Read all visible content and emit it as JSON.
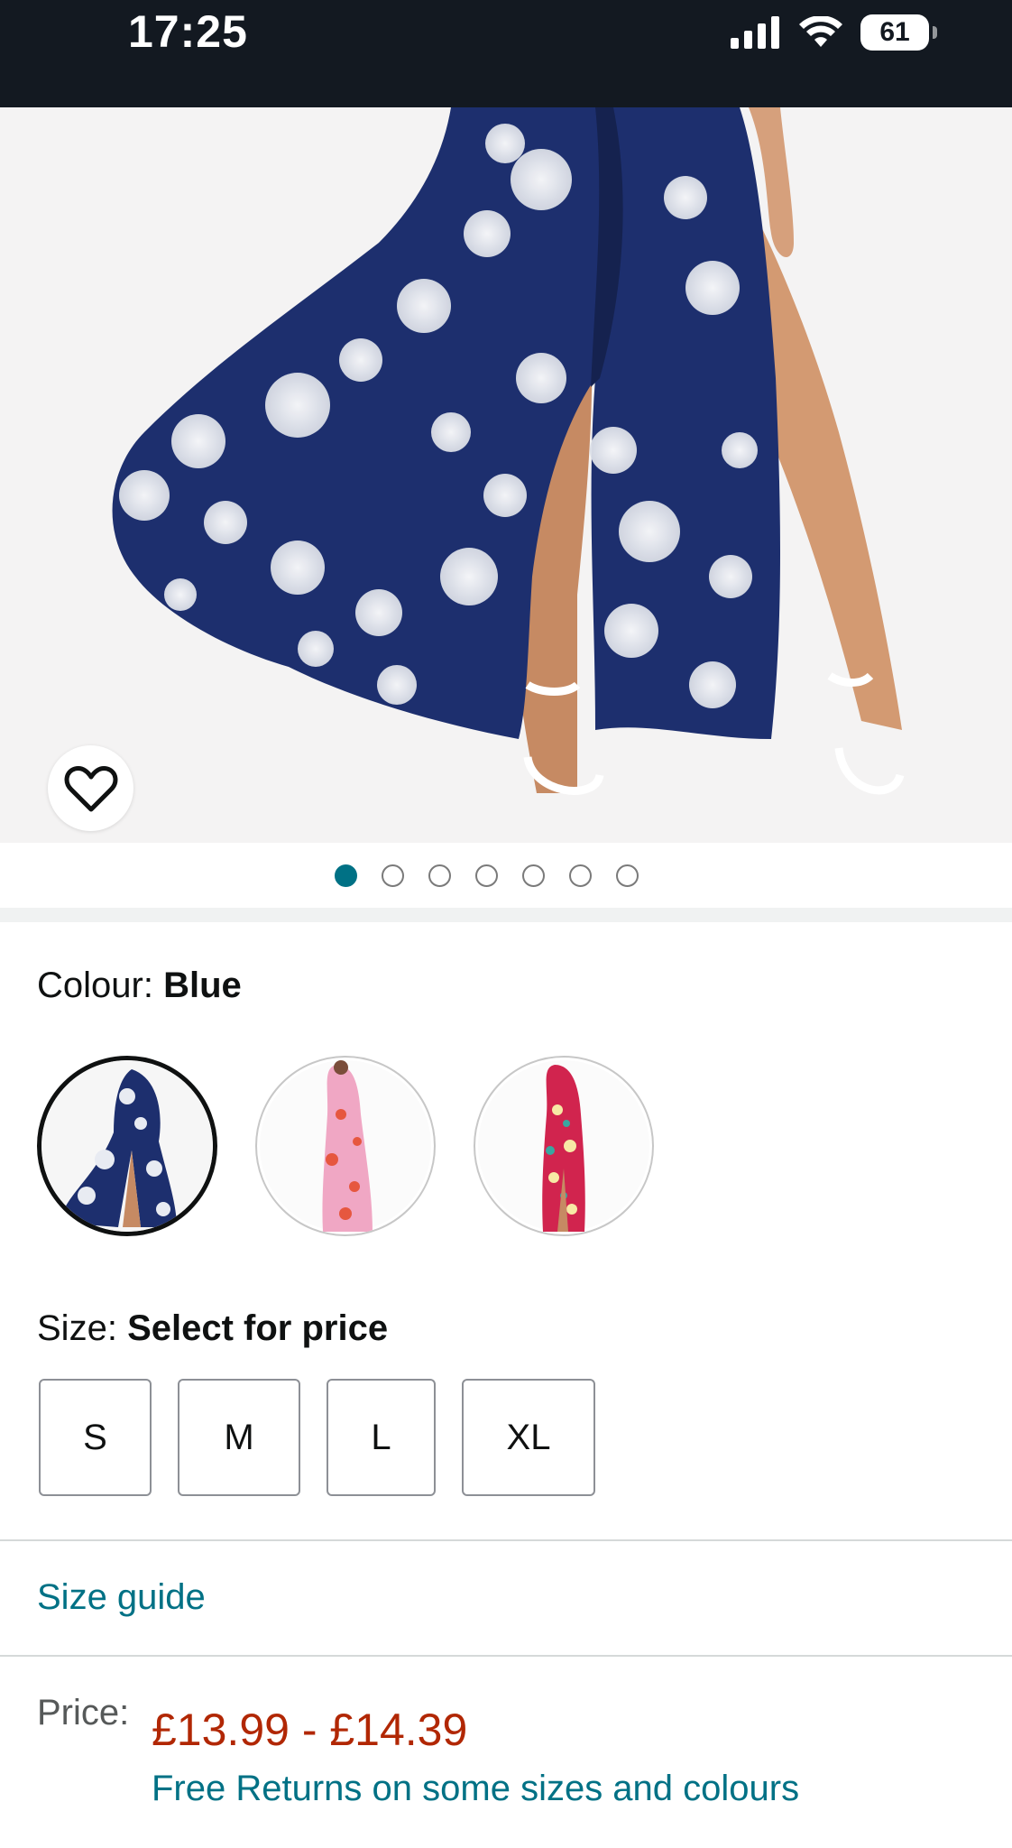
{
  "status_bar": {
    "time": "17:25",
    "battery": "61",
    "icons": [
      "signal-icon",
      "wifi-icon",
      "battery-icon"
    ]
  },
  "product_image": {
    "alt_icon": "wishlist-heart-icon",
    "carousel": {
      "total": 7,
      "active": 1
    }
  },
  "colour": {
    "label": "Colour:",
    "value": "Blue",
    "swatches": [
      "blue-floral",
      "pink-floral",
      "red-floral"
    ]
  },
  "size": {
    "label": "Size:",
    "value": "Select for price",
    "options": [
      "S",
      "M",
      "L",
      "XL"
    ]
  },
  "size_guide": "Size guide",
  "price": {
    "label": "Price:",
    "value": "£13.99 - £14.39",
    "returns": "Free Returns on some sizes and colours"
  },
  "colors": {
    "header": "#131921",
    "link": "#007185",
    "price": "#b12704",
    "dot_active": "#007185"
  }
}
